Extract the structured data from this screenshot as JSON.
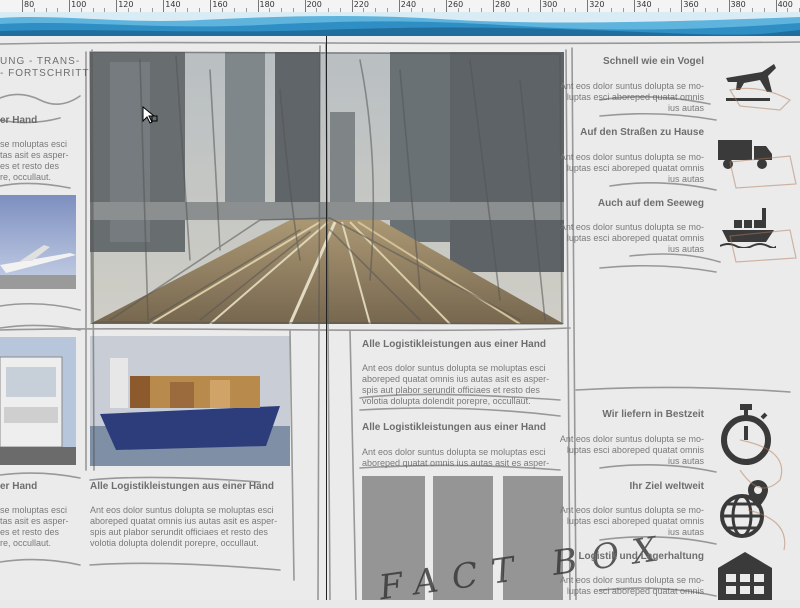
{
  "ruler": {
    "labels": [
      "80",
      "100",
      "120",
      "140",
      "160",
      "180",
      "200",
      "220",
      "240",
      "260",
      "280",
      "300",
      "320",
      "340",
      "360",
      "380",
      "400"
    ]
  },
  "left_column": {
    "top_heading_lines": [
      "UNG - TRANS-",
      "- FORTSCHRITT"
    ],
    "section1_heading": "er Hand",
    "section1_text": [
      "se moluptas esci",
      "tas asit es asper-",
      "es et resto des",
      "re, occullaut."
    ],
    "section2_heading": "er Hand",
    "section2_text": [
      "se moluptas esci",
      "tas asit es asper-",
      "es et resto des",
      "re, occullaut."
    ]
  },
  "hero": {
    "alt": "City skyline with light trails"
  },
  "ship_card": {
    "heading": "Alle Logistikleistungen aus einer Hand",
    "text": [
      "Ant eos dolor suntus dolupta se moluptas esci",
      "aboreped quatat omnis ius autas asit es asper-",
      "spis aut plabor serundit officiaes et resto des",
      "volotia dolupta dolendit porepre, occullaut."
    ]
  },
  "middle": {
    "block1_heading": "Alle Logistikleistungen aus einer Hand",
    "block1_text": [
      "Ant eos dolor suntus dolupta se moluptas esci",
      "aboreped quatat omnis ius autas asit es asper-",
      "spis aut plabor serundit officiaes et resto des",
      "volotia dolupta dolendit porepre, occullaut."
    ],
    "block2_heading": "Alle Logistikleistungen aus einer Hand",
    "block2_text": [
      "Ant eos dolor suntus dolupta se moluptas esci",
      "aboreped quatat omnis ius autas asit es asper-"
    ],
    "factbox_label": "FACT BOX"
  },
  "right_column": {
    "items": [
      {
        "heading": "Schnell wie ein Vogel",
        "text": [
          "Ant eos dolor suntus dolupta se mo-",
          "luptas esci aboreped quatat omnis",
          "ius autas"
        ],
        "icon": "airplane-icon"
      },
      {
        "heading": "Auf den Straßen zu Hause",
        "text": [
          "Ant eos dolor suntus dolupta se mo-",
          "luptas esci aboreped quatat omnis",
          "ius autas"
        ],
        "icon": "truck-icon"
      },
      {
        "heading": "Auch auf dem Seeweg",
        "text": [
          "Ant eos dolor suntus dolupta se mo-",
          "luptas esci aboreped quatat omnis",
          "ius autas"
        ],
        "icon": "ship-icon"
      },
      {
        "heading": "Wir liefern in Bestzeit",
        "text": [
          "Ant eos dolor suntus dolupta se mo-",
          "luptas esci aboreped quatat omnis",
          "ius autas"
        ],
        "icon": "stopwatch-icon"
      },
      {
        "heading": "Ihr Ziel weltweit",
        "text": [
          "Ant eos dolor suntus dolupta se mo-",
          "luptas esci aboreped quatat omnis",
          "ius autas"
        ],
        "icon": "globe-pin-icon"
      },
      {
        "heading": "Logistik und Lagerhaltung",
        "text": [
          "Ant eos dolor suntus dolupta se mo-",
          "luptas esci aboreped quatat omnis"
        ],
        "icon": "warehouse-icon"
      }
    ]
  },
  "colors": {
    "wave_blue": "#3a9ccf",
    "text_grey": "#7a7a7a",
    "heading_grey": "#6e6e6e",
    "sketch": "#555555",
    "icon": "#3a3a3a"
  }
}
